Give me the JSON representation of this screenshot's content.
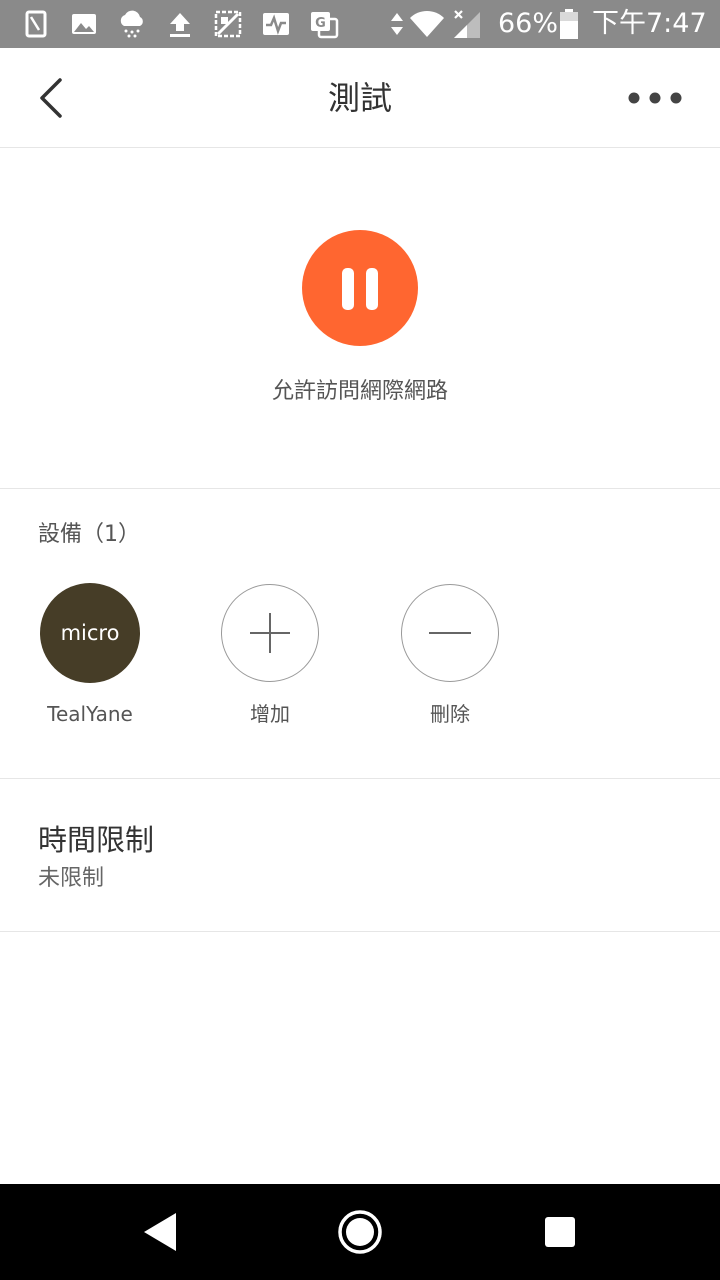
{
  "status_bar": {
    "battery_percent": "66%",
    "time": "下午7:47",
    "icons": [
      "sim-icon",
      "image-icon",
      "cloud-rain-icon",
      "upload-icon",
      "scan-icon",
      "activity-icon",
      "translate-icon",
      "data-arrows-icon",
      "wifi-icon",
      "signal-icon",
      "battery-icon"
    ]
  },
  "header": {
    "title": "測試",
    "back_icon": "chevron-left-icon",
    "more_icon": "more-horizontal-icon"
  },
  "access": {
    "state_icon": "pause-icon",
    "label": "允許訪問網際網路",
    "accent_color": "#ff6630"
  },
  "devices": {
    "heading": "設備（1）",
    "items": [
      {
        "avatar_text": "micro",
        "name": "TealYane",
        "avatar_color": "#463d27"
      }
    ],
    "add_label": "增加",
    "remove_label": "刪除"
  },
  "time_limit": {
    "title": "時間限制",
    "value": "未限制"
  },
  "nav_bar": {
    "icons": [
      "back-triangle-icon",
      "home-circle-icon",
      "recents-square-icon"
    ]
  }
}
